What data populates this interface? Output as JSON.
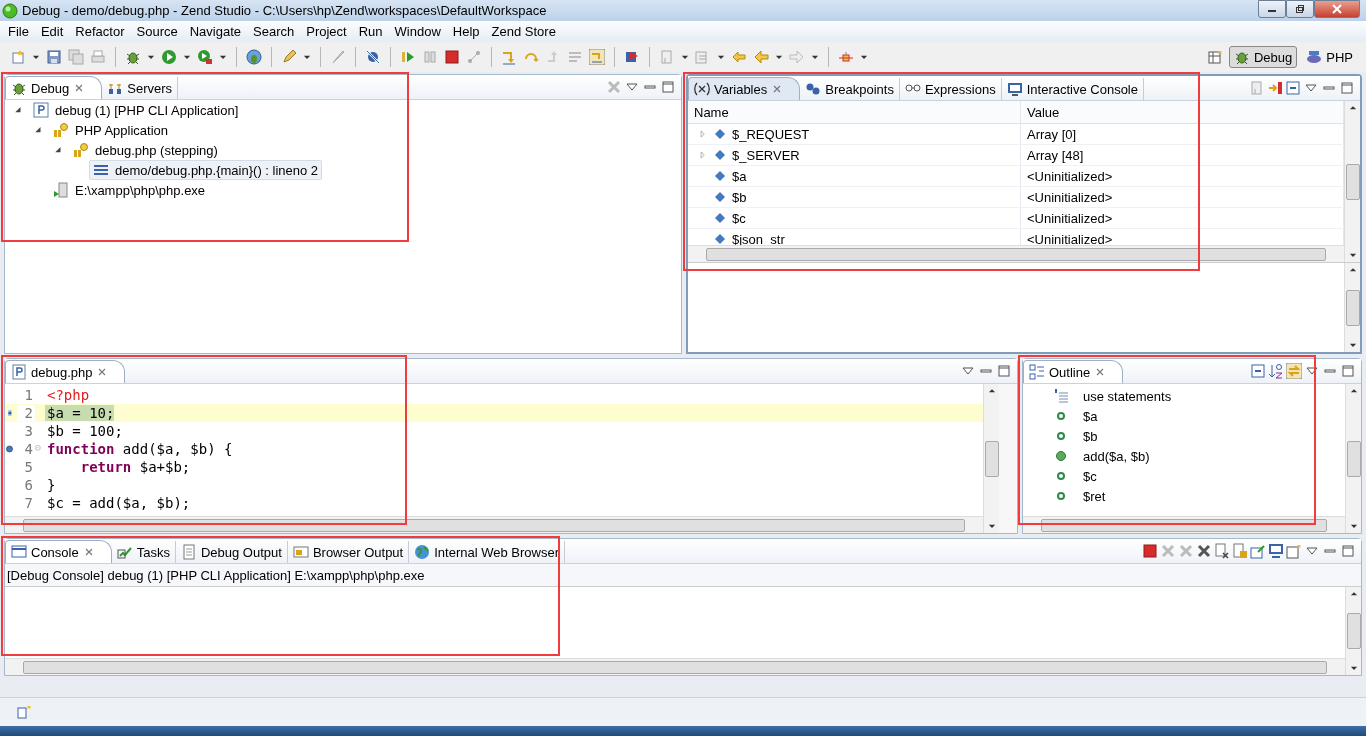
{
  "window": {
    "title": "Debug - demo/debug.php - Zend Studio - C:\\Users\\hp\\Zend\\workspaces\\DefaultWorkspace"
  },
  "menu": [
    "File",
    "Edit",
    "Refactor",
    "Source",
    "Navigate",
    "Search",
    "Project",
    "Run",
    "Window",
    "Help",
    "Zend Store"
  ],
  "perspectives": [
    {
      "label": "Debug",
      "selected": true
    },
    {
      "label": "PHP",
      "selected": false
    }
  ],
  "debug_view": {
    "tabs": [
      {
        "label": "Debug",
        "selected": true
      },
      {
        "label": "Servers",
        "selected": false
      }
    ],
    "tree": [
      {
        "label": "debug (1) [PHP CLI Application]",
        "kind": "launch",
        "expanded": true,
        "selected": false,
        "children": [
          {
            "label": "PHP Application",
            "kind": "application",
            "expanded": true,
            "selected": false,
            "children": [
              {
                "label": "debug.php (stepping)",
                "kind": "thread",
                "expanded": true,
                "selected": false,
                "children": [
                  {
                    "label": "demo/debug.php.{main}() : lineno 2",
                    "kind": "frame",
                    "selected": true
                  }
                ]
              }
            ]
          },
          {
            "label": "E:\\xampp\\php\\php.exe",
            "kind": "process",
            "selected": false
          }
        ]
      }
    ]
  },
  "variables_view": {
    "tabs": [
      {
        "label": "Variables",
        "selected": true
      },
      {
        "label": "Breakpoints",
        "selected": false
      },
      {
        "label": "Expressions",
        "selected": false
      },
      {
        "label": "Interactive Console",
        "selected": false
      }
    ],
    "columns": [
      "Name",
      "Value"
    ],
    "rows": [
      {
        "name": "$_REQUEST",
        "value": "Array [0]",
        "expandable": true
      },
      {
        "name": "$_SERVER",
        "value": "Array [48]",
        "expandable": true
      },
      {
        "name": "$a",
        "value": "<Uninitialized>",
        "expandable": false
      },
      {
        "name": "$b",
        "value": "<Uninitialized>",
        "expandable": false
      },
      {
        "name": "$c",
        "value": "<Uninitialized>",
        "expandable": false
      },
      {
        "name": "$json_str",
        "value": "<Uninitialized>",
        "expandable": false
      }
    ]
  },
  "editor": {
    "tabs": [
      {
        "label": "debug.php",
        "selected": true
      }
    ],
    "lines": [
      {
        "number": "1",
        "current": false,
        "breakpoint": false,
        "foldable": false,
        "tokens": [
          {
            "text": "<?php",
            "kind": "tag"
          }
        ]
      },
      {
        "number": "2",
        "current": true,
        "breakpoint": false,
        "foldable": false,
        "tokens": [
          {
            "text": "$a = 10;",
            "kind": "plain"
          }
        ]
      },
      {
        "number": "3",
        "current": false,
        "breakpoint": false,
        "foldable": false,
        "tokens": [
          {
            "text": "$b = 100;",
            "kind": "plain"
          }
        ]
      },
      {
        "number": "4",
        "current": false,
        "breakpoint": true,
        "foldable": true,
        "tokens": [
          {
            "text": "function",
            "kind": "keyword"
          },
          {
            "text": " add($a, $b) {",
            "kind": "plain"
          }
        ]
      },
      {
        "number": "5",
        "current": false,
        "breakpoint": false,
        "foldable": false,
        "tokens": [
          {
            "text": "    return",
            "kind": "keyword"
          },
          {
            "text": " $a+$b;",
            "kind": "plain"
          }
        ]
      },
      {
        "number": "6",
        "current": false,
        "breakpoint": false,
        "foldable": false,
        "tokens": [
          {
            "text": "}",
            "kind": "plain"
          }
        ]
      },
      {
        "number": "7",
        "current": false,
        "breakpoint": false,
        "foldable": false,
        "tokens": [
          {
            "text": "$c = add($a, $b);",
            "kind": "plain"
          }
        ]
      }
    ]
  },
  "outline": {
    "tabs": [
      {
        "label": "Outline",
        "selected": true
      }
    ],
    "items": [
      {
        "label": "use statements",
        "kind": "use"
      },
      {
        "label": "$a",
        "kind": "variable"
      },
      {
        "label": "$b",
        "kind": "variable"
      },
      {
        "label": "add($a, $b)",
        "kind": "function"
      },
      {
        "label": "$c",
        "kind": "variable"
      },
      {
        "label": "$ret",
        "kind": "variable"
      }
    ]
  },
  "console": {
    "tabs": [
      {
        "label": "Console",
        "selected": true
      },
      {
        "label": "Tasks",
        "selected": false
      },
      {
        "label": "Debug Output",
        "selected": false
      },
      {
        "label": "Browser Output",
        "selected": false
      },
      {
        "label": "Internal Web Browser",
        "selected": false
      }
    ],
    "description": "[Debug Console] debug (1) [PHP CLI Application] E:\\xampp\\php\\php.exe"
  }
}
